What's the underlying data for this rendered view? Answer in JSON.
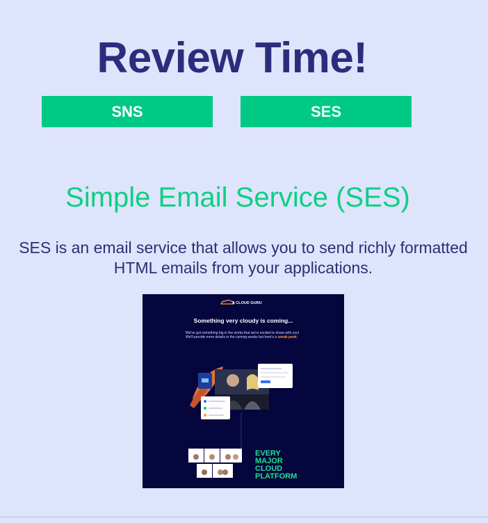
{
  "slide": {
    "title": "Review Time!",
    "tabs": [
      {
        "label": "SNS"
      },
      {
        "label": "SES"
      }
    ],
    "heading": "Simple Email Service (SES)",
    "description": "SES is an email service that allows you to send richly formatted HTML emails from your applications."
  },
  "email_preview": {
    "brand": "A CLOUD GURU",
    "headline": "Something very cloudy is coming...",
    "body": "We've got something big in the works that we're excited to share with you! We'll provide more details in the coming weeks but here's a",
    "link": "sneak peek:",
    "promo_lines": [
      "EVERY",
      "MAJOR",
      "CLOUD",
      "PLATFORM"
    ]
  },
  "colors": {
    "background": "#dee4fb",
    "title": "#2b2d7c",
    "accent_green": "#00c985",
    "email_bg": "#06063e"
  }
}
